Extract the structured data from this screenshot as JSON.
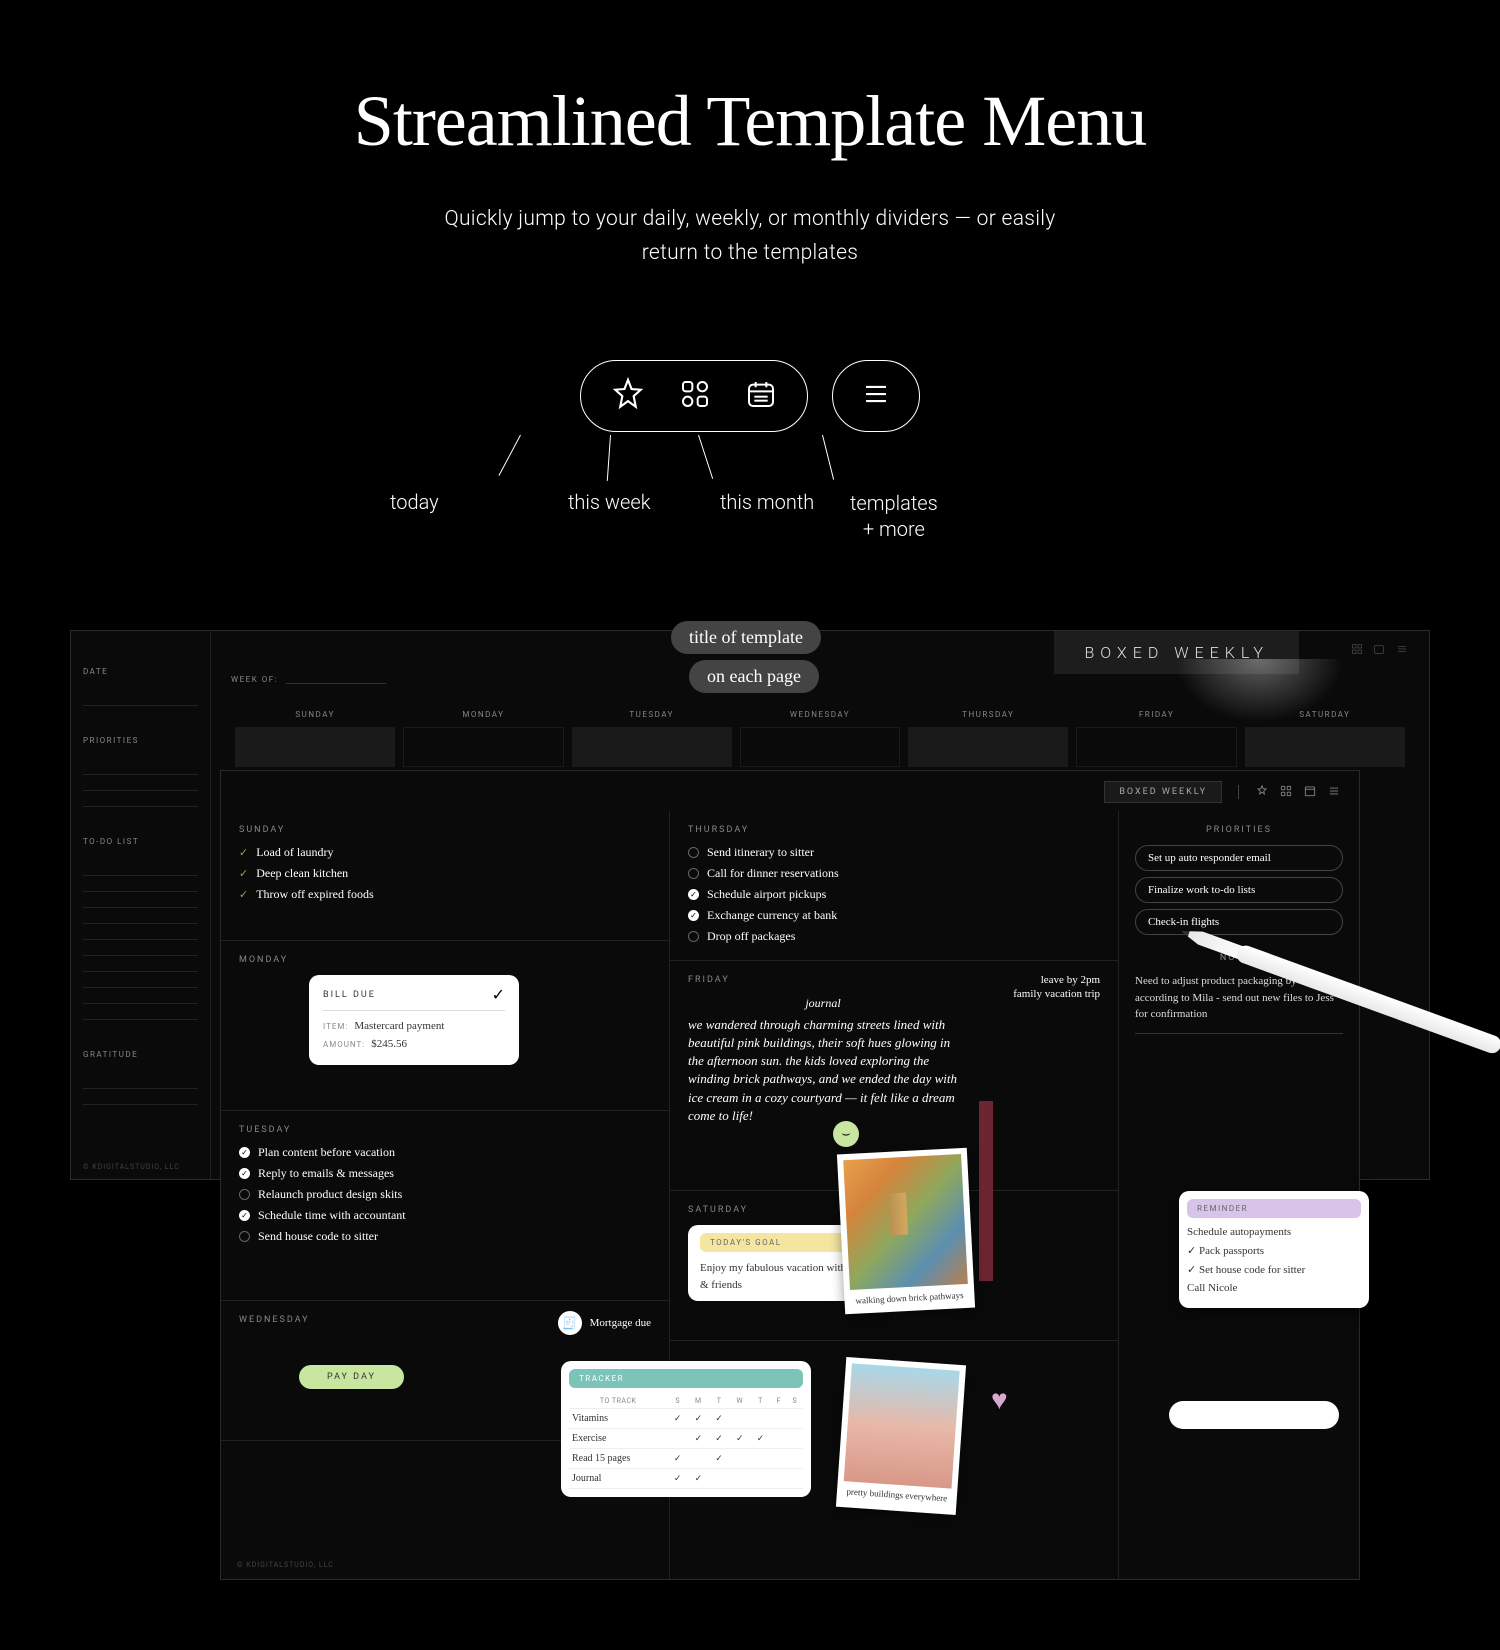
{
  "hero": {
    "title": "Streamlined Template Menu",
    "subtitle_l1": "Quickly jump to your daily, weekly, or monthly dividers — or easily",
    "subtitle_l2": "return to the templates"
  },
  "diagram": {
    "labels": [
      "today",
      "this week",
      "this month",
      "templates\n+ more"
    ]
  },
  "title_badge": {
    "l1": "title of template",
    "l2": "on each page"
  },
  "boxed_weekly": "BOXED  WEEKLY",
  "back": {
    "date": "DATE",
    "priorities": "PRIORITIES",
    "todo": "TO-DO LIST",
    "gratitude": "GRATITUDE",
    "weekof": "WEEK OF:",
    "days": [
      "SUNDAY",
      "MONDAY",
      "TUESDAY",
      "WEDNESDAY",
      "THURSDAY",
      "FRIDAY",
      "SATURDAY"
    ],
    "footer": "© KDIGITALSTUDIO, LLC"
  },
  "front": {
    "badge": "BOXED  WEEKLY",
    "footer": "© KDIGITALSTUDIO, LLC",
    "days": {
      "sunday": {
        "label": "SUNDAY",
        "tasks": [
          "Load of laundry",
          "Deep clean kitchen",
          "Throw off expired foods"
        ]
      },
      "monday": {
        "label": "MONDAY"
      },
      "tuesday": {
        "label": "TUESDAY",
        "tasks": [
          "Plan content before vacation",
          "Reply to emails & messages",
          "Relaunch product design skits",
          "Schedule time with accountant",
          "Send house code to sitter"
        ]
      },
      "wednesday": {
        "label": "WEDNESDAY"
      },
      "thursday": {
        "label": "THURSDAY",
        "tasks": [
          "Send itinerary to sitter",
          "Call for dinner reservations",
          "Schedule airport pickups",
          "Exchange currency at bank",
          "Drop off packages"
        ]
      },
      "friday": {
        "label": "FRIDAY"
      },
      "saturday": {
        "label": "SATURDAY"
      }
    },
    "bill": {
      "title": "BILL DUE",
      "item_lbl": "ITEM:",
      "item": "Mastercard payment",
      "amount_lbl": "AMOUNT:",
      "amount": "$245.56"
    },
    "payday": "PAY DAY",
    "mortgage": "Mortgage due",
    "journal": {
      "title": "journal",
      "body": "we wandered through charming streets lined with beautiful pink buildings, their soft hues glowing in the afternoon sun. the kids loved exploring the winding brick pathways, and we ended the day with ice cream in a cozy courtyard — it felt like a dream come to life!"
    },
    "vacation": {
      "l1": "leave by 2pm",
      "l2": "family vacation trip"
    },
    "goal": {
      "title": "TODAY'S GOAL",
      "text": "Enjoy my fabulous vacation with closest family & friends"
    },
    "priorities_label": "PRIORITIES",
    "priorities": [
      "Set up auto responder email",
      "Finalize work to-do lists",
      "Check-in flights"
    ],
    "notes_label": "NOTES",
    "notes": "Need to adjust product packaging by 0.5cm according to Mila - send out new files to Jess for confirmation",
    "photo1_cap": "walking down brick pathways",
    "photo2_cap": "pretty buildings everywhere",
    "tracker": {
      "title": "TRACKER",
      "cols": [
        "TO TRACK",
        "S",
        "M",
        "T",
        "W",
        "T",
        "F",
        "S"
      ],
      "rows": [
        {
          "name": "Vitamins",
          "v": [
            "✓",
            "✓",
            "✓",
            "",
            "",
            "",
            ""
          ]
        },
        {
          "name": "Exercise",
          "v": [
            "",
            "✓",
            "✓",
            "✓",
            "✓",
            "",
            ""
          ]
        },
        {
          "name": "Read 15 pages",
          "v": [
            "✓",
            "",
            "✓",
            "",
            "",
            "",
            ""
          ]
        },
        {
          "name": "Journal",
          "v": [
            "✓",
            "✓",
            "",
            "",
            "",
            "",
            ""
          ]
        }
      ]
    },
    "reminder": {
      "title": "REMINDER",
      "items": [
        "Schedule autopayments",
        "✓ Pack passports",
        "✓ Set house code for sitter",
        "Call Nicole"
      ]
    }
  }
}
